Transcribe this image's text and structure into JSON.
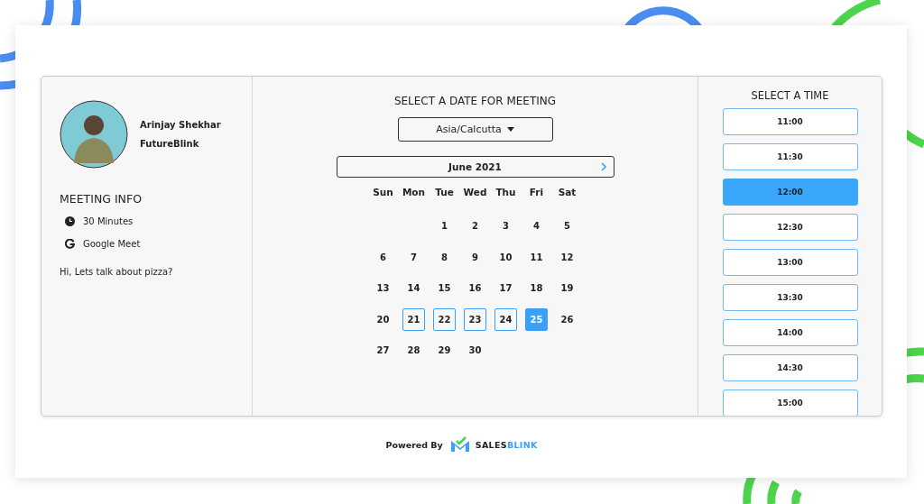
{
  "host": {
    "name": "Arinjay Shekhar",
    "company": "FutureBlink"
  },
  "meeting_info": {
    "title": "MEETING INFO",
    "items": [
      {
        "kind": "duration",
        "text": "30 Minutes"
      },
      {
        "kind": "location",
        "text": "Google Meet"
      }
    ],
    "description": "Hi, Lets talk about pizza?"
  },
  "date_picker": {
    "title": "SELECT A DATE FOR MEETING",
    "timezone": "Asia/Calcutta",
    "month": "June 2021",
    "weekdays": [
      "Sun",
      "Mon",
      "Tue",
      "Wed",
      "Thu",
      "Fri",
      "Sat"
    ],
    "weeks": [
      [
        {
          "day": "1",
          "available": false,
          "selected": false
        },
        {
          "day": "2",
          "available": false,
          "selected": false
        },
        {
          "day": "3",
          "available": false,
          "selected": false
        },
        {
          "day": "4",
          "available": false,
          "selected": false
        },
        {
          "day": "5",
          "available": false,
          "selected": false
        }
      ],
      [
        {
          "day": "6",
          "available": false,
          "selected": false
        },
        {
          "day": "7",
          "available": false,
          "selected": false
        },
        {
          "day": "8",
          "available": false,
          "selected": false
        },
        {
          "day": "9",
          "available": false,
          "selected": false
        },
        {
          "day": "10",
          "available": false,
          "selected": false
        },
        {
          "day": "11",
          "available": false,
          "selected": false
        },
        {
          "day": "12",
          "available": false,
          "selected": false
        }
      ],
      [
        {
          "day": "13",
          "available": false,
          "selected": false
        },
        {
          "day": "14",
          "available": false,
          "selected": false
        },
        {
          "day": "15",
          "available": false,
          "selected": false
        },
        {
          "day": "16",
          "available": false,
          "selected": false
        },
        {
          "day": "17",
          "available": false,
          "selected": false
        },
        {
          "day": "18",
          "available": false,
          "selected": false
        },
        {
          "day": "19",
          "available": false,
          "selected": false
        }
      ],
      [
        {
          "day": "20",
          "available": false,
          "selected": false
        },
        {
          "day": "21",
          "available": true,
          "selected": false
        },
        {
          "day": "22",
          "available": true,
          "selected": false
        },
        {
          "day": "23",
          "available": true,
          "selected": false
        },
        {
          "day": "24",
          "available": true,
          "selected": false
        },
        {
          "day": "25",
          "available": true,
          "selected": true
        },
        {
          "day": "26",
          "available": false,
          "selected": false
        }
      ],
      [
        {
          "day": "27",
          "available": false,
          "selected": false
        },
        {
          "day": "28",
          "available": false,
          "selected": false
        },
        {
          "day": "29",
          "available": false,
          "selected": false
        },
        {
          "day": "30",
          "available": false,
          "selected": false
        }
      ]
    ]
  },
  "time_picker": {
    "title": "SELECT A TIME",
    "slots": [
      {
        "time": "11:00",
        "selected": false
      },
      {
        "time": "11:30",
        "selected": false
      },
      {
        "time": "12:00",
        "selected": true
      },
      {
        "time": "12:30",
        "selected": false
      },
      {
        "time": "13:00",
        "selected": false
      },
      {
        "time": "13:30",
        "selected": false
      },
      {
        "time": "14:00",
        "selected": false
      },
      {
        "time": "14:30",
        "selected": false
      },
      {
        "time": "15:00",
        "selected": false
      }
    ]
  },
  "footer": {
    "powered_by": "Powered By",
    "brand_first": "SALES",
    "brand_second": "BLINK"
  }
}
